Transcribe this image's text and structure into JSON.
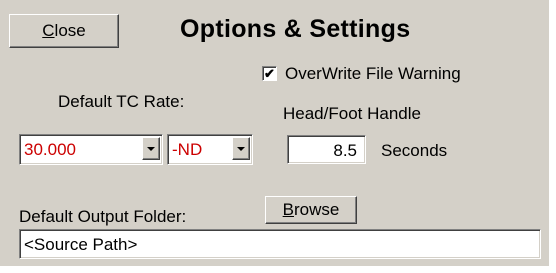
{
  "dialog": {
    "title": "Options & Settings",
    "close_button": {
      "mnemonic": "C",
      "rest": "lose"
    },
    "overwrite": {
      "label": "OverWrite File Warning",
      "checked": true,
      "check_glyph": "✔"
    },
    "tc_rate": {
      "label": "Default TC Rate:",
      "rate_value": "30.000",
      "drop_value": "-ND"
    },
    "handle": {
      "label": "Head/Foot  Handle",
      "value": "8.5",
      "unit": "Seconds"
    },
    "output_folder": {
      "label": "Default Output Folder:",
      "browse_button": {
        "mnemonic": "B",
        "rest": "rowse"
      },
      "path": "<Source Path>"
    },
    "colors": {
      "face": "#d4d0c8",
      "value_text": "#cc0000"
    }
  }
}
